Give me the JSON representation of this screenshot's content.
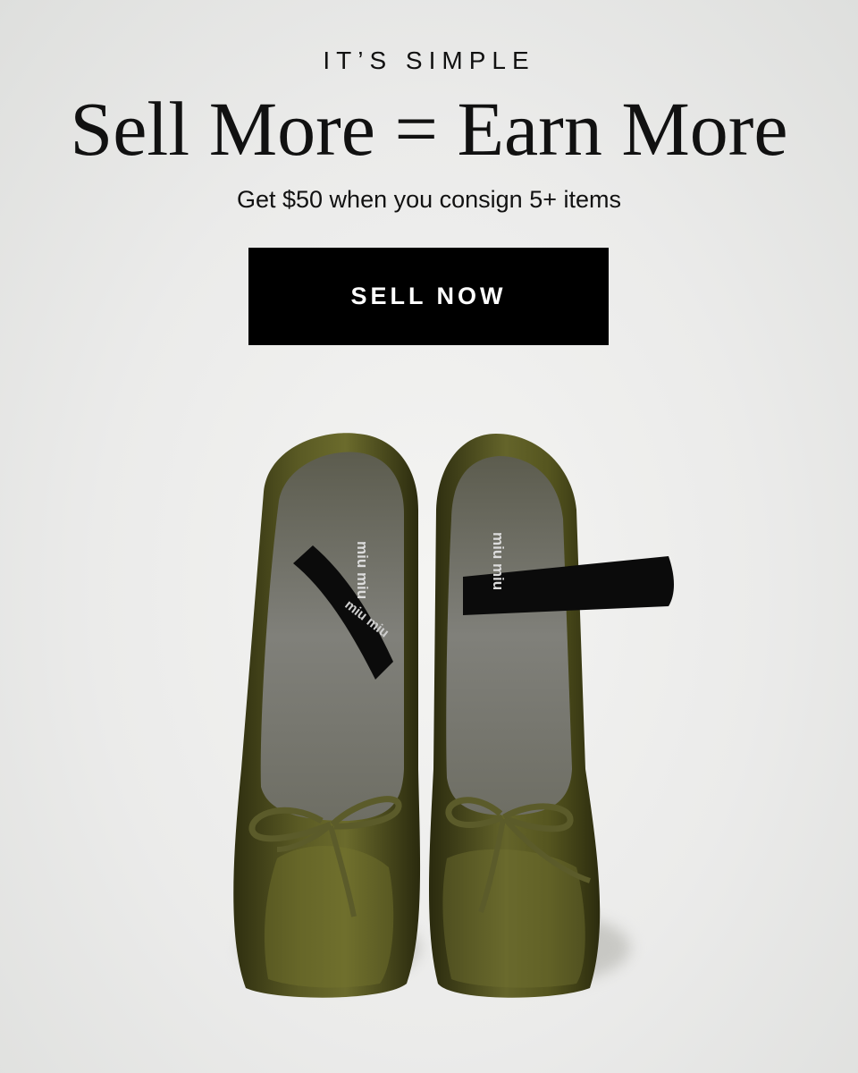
{
  "hero": {
    "eyebrow": "IT’S SIMPLE",
    "headline": "Sell More = Earn More",
    "subline": "Get $50 when you consign 5+ items",
    "cta_label": "SELL NOW"
  },
  "product": {
    "insole_brand_text": "miu miu",
    "strap_brand_text": "miu miu",
    "colors": {
      "satin": "#4a4a1e",
      "insole": "#77776a",
      "strap": "#0b0b0b",
      "background": "#ececea"
    }
  }
}
